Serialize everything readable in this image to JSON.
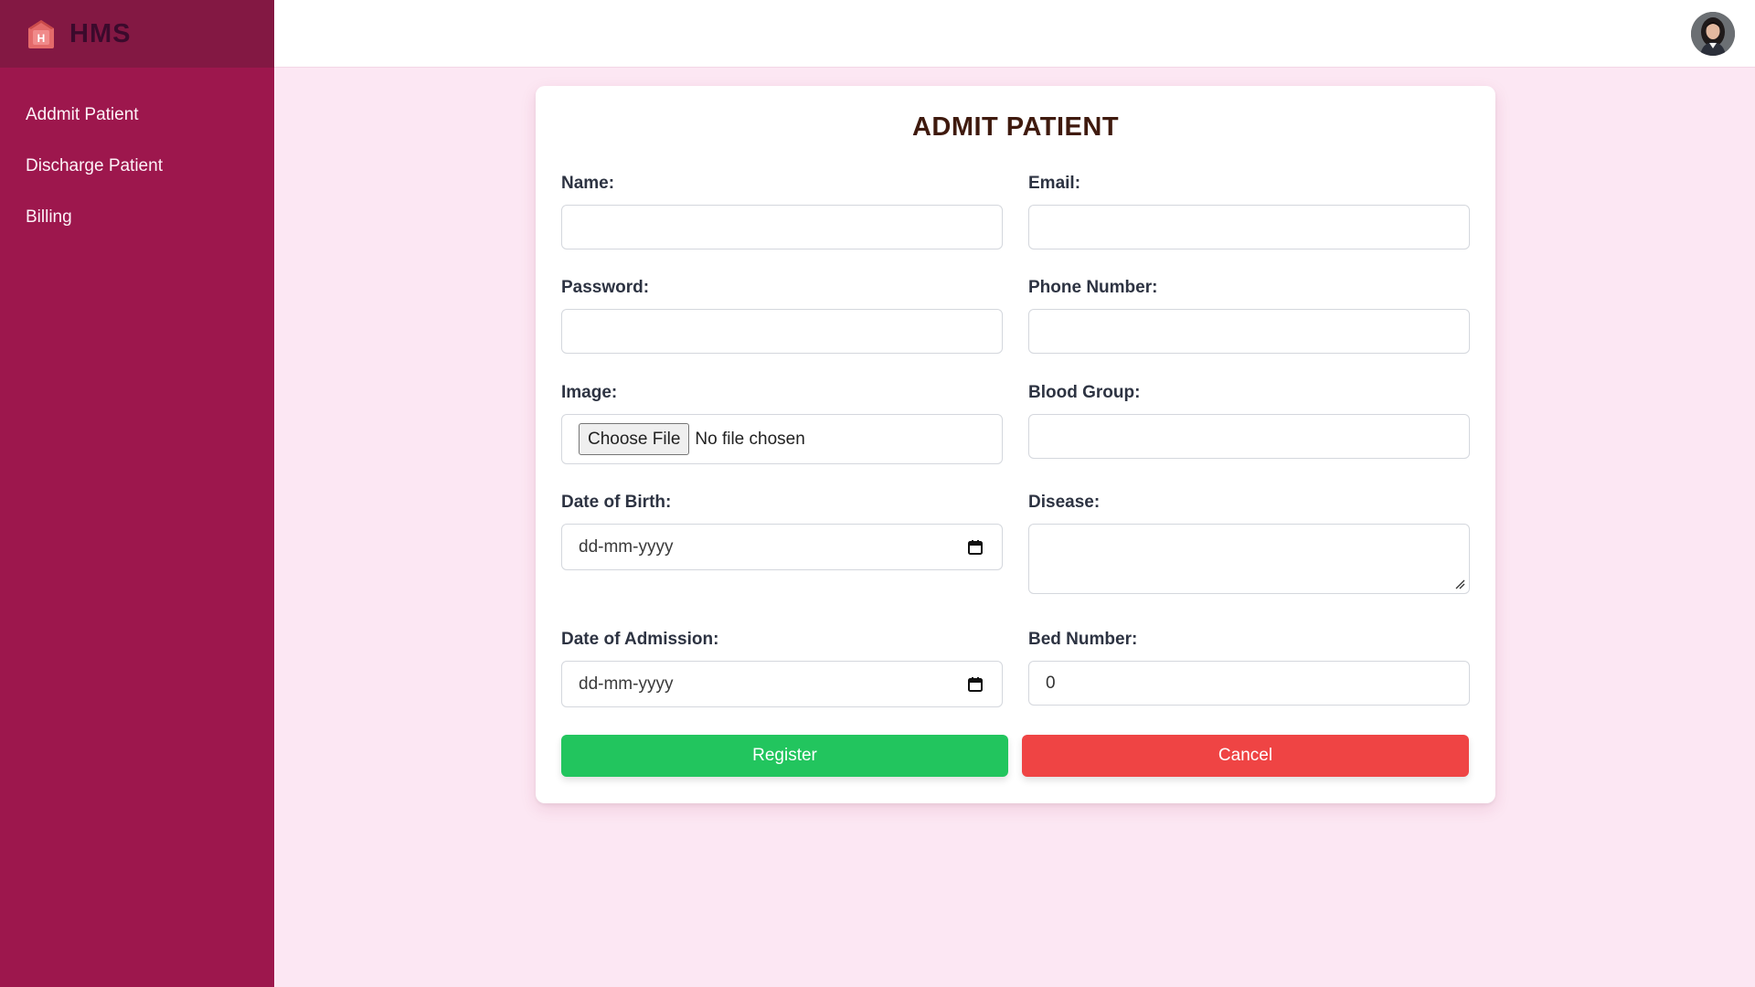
{
  "app": {
    "brand": "HMS"
  },
  "sidebar": {
    "items": [
      {
        "label": "Addmit Patient"
      },
      {
        "label": "Discharge Patient"
      },
      {
        "label": "Billing"
      }
    ]
  },
  "form": {
    "title": "ADMIT PATIENT",
    "name": {
      "label": "Name:",
      "value": ""
    },
    "email": {
      "label": "Email:",
      "value": ""
    },
    "password": {
      "label": "Password:",
      "value": ""
    },
    "phone": {
      "label": "Phone Number:",
      "value": ""
    },
    "image": {
      "label": "Image:",
      "button": "Choose File",
      "status": "No file chosen"
    },
    "blood_group": {
      "label": "Blood Group:",
      "value": ""
    },
    "dob": {
      "label": "Date of Birth:",
      "placeholder": "dd-mm-yyyy"
    },
    "disease": {
      "label": "Disease:",
      "value": ""
    },
    "admission": {
      "label": "Date of Admission:",
      "placeholder": "dd-mm-yyyy"
    },
    "bed": {
      "label": "Bed Number:",
      "value": "0"
    },
    "register_label": "Register",
    "cancel_label": "Cancel"
  },
  "colors": {
    "sidebar": "#9d174d",
    "brand_bar": "#831843",
    "page_bg": "#fce7f3",
    "register": "#22c55e",
    "cancel": "#ef4444"
  },
  "icons": [
    "hospital-logo-icon",
    "calendar-icon",
    "resize-handle-icon",
    "user-avatar"
  ]
}
